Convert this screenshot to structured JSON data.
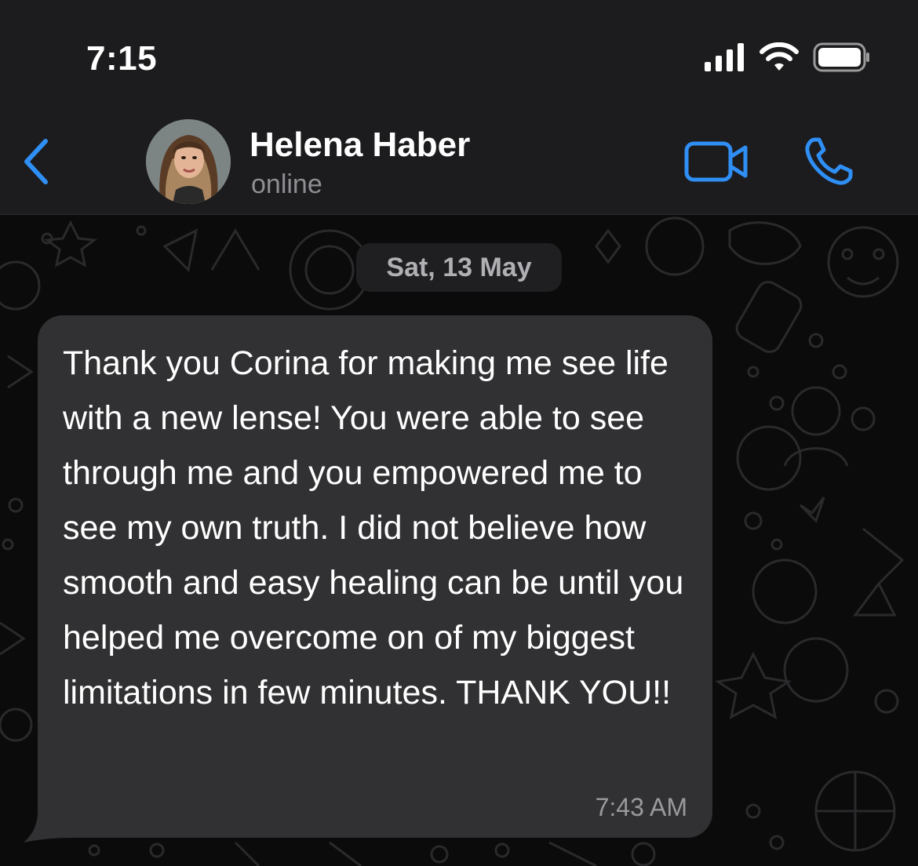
{
  "status_bar": {
    "time": "7:15"
  },
  "header": {
    "contact_name": "Helena Haber",
    "contact_status": "online"
  },
  "chat": {
    "date_label": "Sat, 13 May",
    "messages": [
      {
        "text": "Thank you Corina for making me see life with a new lense! You were able to see through me and you empowered me to see my own truth. I did not believe how smooth and easy healing can be until you helped me overcome on of my biggest limitations in few minutes. THANK YOU!!",
        "time": "7:43 AM",
        "direction": "incoming"
      }
    ]
  },
  "colors": {
    "accent": "#2f8ff5",
    "bubble": "#313133",
    "background": "#0b0b0b",
    "header": "#1c1c1e"
  },
  "icons": [
    "signal-icon",
    "wifi-icon",
    "battery-icon",
    "back-chevron-icon",
    "video-call-icon",
    "phone-call-icon"
  ]
}
